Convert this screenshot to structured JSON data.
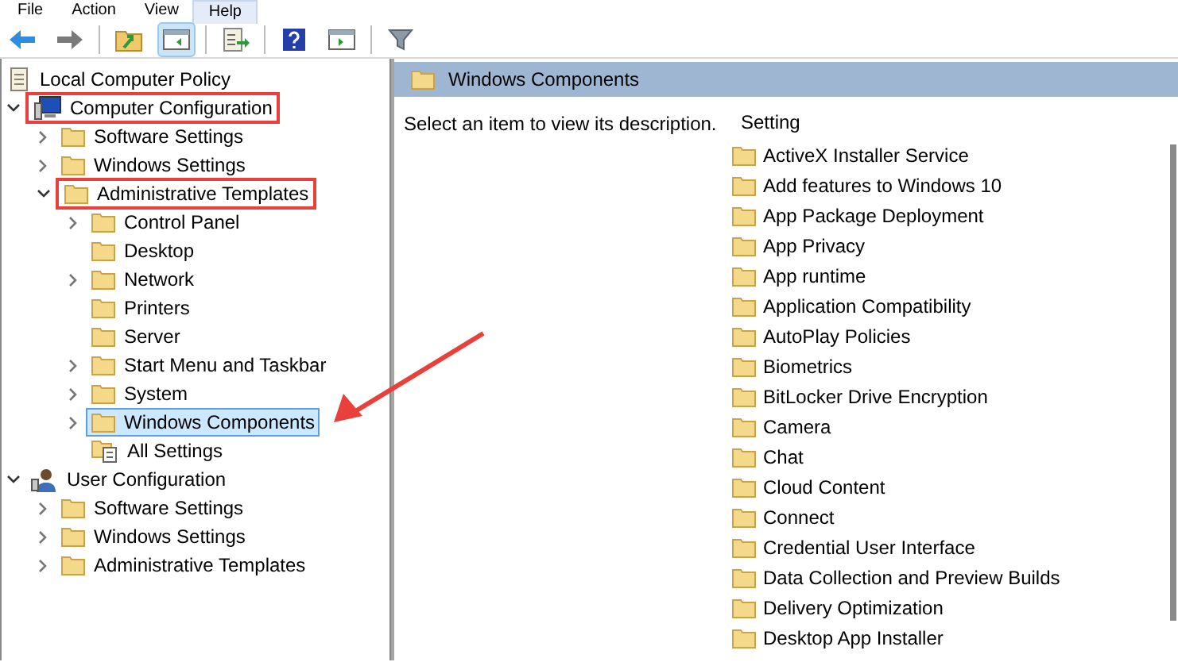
{
  "menu": [
    {
      "label": "File",
      "selected": false
    },
    {
      "label": "Action",
      "selected": false
    },
    {
      "label": "View",
      "selected": false
    },
    {
      "label": "Help",
      "selected": true
    }
  ],
  "toolbar": [
    {
      "kind": "back"
    },
    {
      "kind": "forward"
    },
    {
      "kind": "sep"
    },
    {
      "kind": "up"
    },
    {
      "kind": "tree",
      "selected": true
    },
    {
      "kind": "sep"
    },
    {
      "kind": "export"
    },
    {
      "kind": "sep"
    },
    {
      "kind": "help"
    },
    {
      "kind": "pane"
    },
    {
      "kind": "sep"
    },
    {
      "kind": "filter"
    }
  ],
  "tree": [
    {
      "label": "Local Computer Policy",
      "kind": "policy",
      "children": [
        {
          "label": "Computer Configuration",
          "kind": "computer",
          "expanded": true,
          "highlighted": true,
          "selected": false,
          "children": [
            {
              "label": "Software Settings",
              "kind": "folder",
              "expanded": false,
              "highlighted": false,
              "selected": false,
              "has_children": true
            },
            {
              "label": "Windows Settings",
              "kind": "folder",
              "expanded": false,
              "highlighted": false,
              "selected": false,
              "has_children": true
            },
            {
              "label": "Administrative Templates",
              "kind": "folder",
              "expanded": true,
              "highlighted": true,
              "selected": false,
              "children": [
                {
                  "label": "Control Panel",
                  "kind": "folder",
                  "expanded": false,
                  "highlighted": false,
                  "selected": false,
                  "has_children": true
                },
                {
                  "label": "Desktop",
                  "kind": "folder",
                  "expanded": false,
                  "highlighted": false,
                  "selected": false,
                  "has_children": false
                },
                {
                  "label": "Network",
                  "kind": "folder",
                  "expanded": false,
                  "highlighted": false,
                  "selected": false,
                  "has_children": true
                },
                {
                  "label": "Printers",
                  "kind": "folder",
                  "expanded": false,
                  "highlighted": false,
                  "selected": false,
                  "has_children": false
                },
                {
                  "label": "Server",
                  "kind": "folder",
                  "expanded": false,
                  "highlighted": false,
                  "selected": false,
                  "has_children": false
                },
                {
                  "label": "Start Menu and Taskbar",
                  "kind": "folder",
                  "expanded": false,
                  "highlighted": false,
                  "selected": false,
                  "has_children": true
                },
                {
                  "label": "System",
                  "kind": "folder",
                  "expanded": false,
                  "highlighted": false,
                  "selected": false,
                  "has_children": true
                },
                {
                  "label": "Windows Components",
                  "kind": "folder",
                  "expanded": false,
                  "highlighted": false,
                  "selected": true,
                  "has_children": true
                },
                {
                  "label": "All Settings",
                  "kind": "settings",
                  "expanded": false,
                  "highlighted": false,
                  "selected": false,
                  "has_children": false
                }
              ]
            }
          ]
        },
        {
          "label": "User Configuration",
          "kind": "user",
          "expanded": true,
          "highlighted": false,
          "selected": false,
          "children": [
            {
              "label": "Software Settings",
              "kind": "folder",
              "expanded": false,
              "highlighted": false,
              "selected": false,
              "has_children": true
            },
            {
              "label": "Windows Settings",
              "kind": "folder",
              "expanded": false,
              "highlighted": false,
              "selected": false,
              "has_children": true
            },
            {
              "label": "Administrative Templates",
              "kind": "folder",
              "expanded": false,
              "highlighted": false,
              "selected": false,
              "has_children": true
            }
          ]
        }
      ]
    }
  ],
  "details": {
    "title": "Windows Components",
    "description": "Select an item to view its description.",
    "column": "Setting",
    "items": [
      "ActiveX Installer Service",
      "Add features to Windows 10",
      "App Package Deployment",
      "App Privacy",
      "App runtime",
      "Application Compatibility",
      "AutoPlay Policies",
      "Biometrics",
      "BitLocker Drive Encryption",
      "Camera",
      "Chat",
      "Cloud Content",
      "Connect",
      "Credential User Interface",
      "Data Collection and Preview Builds",
      "Delivery Optimization",
      "Desktop App Installer"
    ]
  }
}
